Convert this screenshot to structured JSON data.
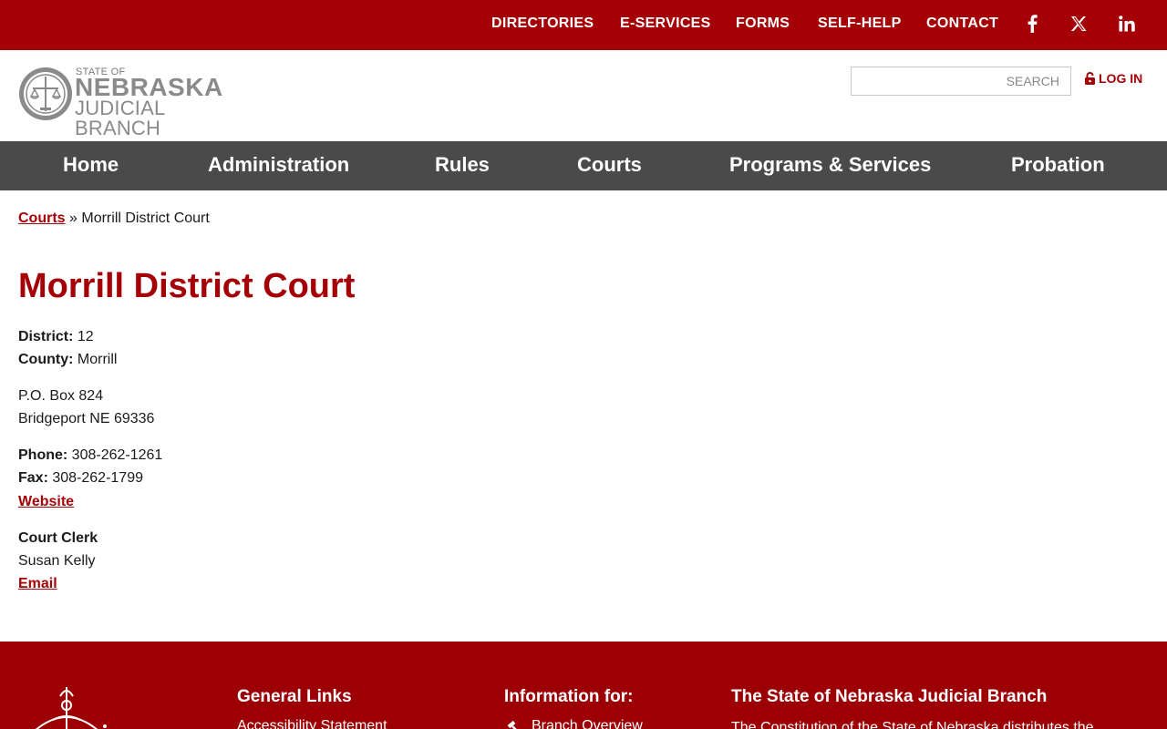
{
  "top_nav": {
    "items": [
      "DIRECTORIES",
      "E-SERVICES",
      "FORMS",
      "SELF-HELP",
      "CONTACT"
    ],
    "social": [
      "facebook-icon",
      "x-icon",
      "linkedin-icon"
    ]
  },
  "logo": {
    "small": "STATE OF",
    "big": "NEBRASKA",
    "mid": "JUDICIAL BRANCH"
  },
  "search": {
    "placeholder": "SEARCH"
  },
  "login": {
    "label": "LOG IN"
  },
  "main_nav": [
    "Home",
    "Administration",
    "Rules",
    "Courts",
    "Programs & Services",
    "Probation"
  ],
  "breadcrumb": {
    "parent": "Courts",
    "separator": "»",
    "current": "Morrill District Court"
  },
  "page": {
    "title": "Morrill District Court",
    "district_label": "District:",
    "district_value": "12",
    "county_label": "County:",
    "county_value": "Morrill",
    "address_line1": "P.O. Box 824",
    "address_line2": "Bridgeport NE 69336",
    "phone_label": "Phone:",
    "phone_value": "308-262-1261",
    "fax_label": "Fax:",
    "fax_value": "308-262-1799",
    "website": "Website",
    "clerk_label": "Court Clerk",
    "clerk_name": "Susan Kelly",
    "email": "Email"
  },
  "footer": {
    "general_links": "General Links",
    "general_first": "Accessibility Statement",
    "info_for": "Information for:",
    "info_first": "Branch Overview",
    "about_title": "The State of Nebraska Judicial Branch",
    "about_text": "The Constitution of the State of Nebraska distributes the"
  },
  "colors": {
    "brand": "#a50005",
    "nav": "#4a4a4a",
    "footer": "#9c0005"
  }
}
